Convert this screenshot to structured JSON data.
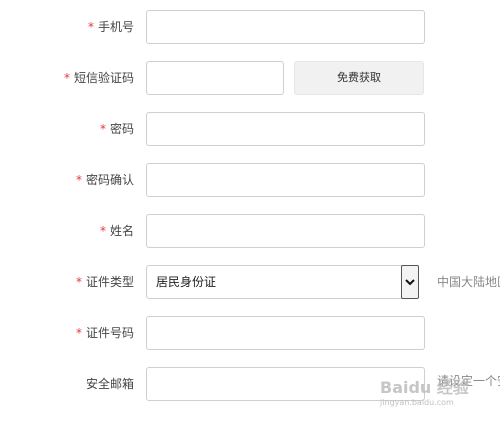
{
  "form": {
    "required_mark": "*",
    "phone": {
      "label": "手机号",
      "value": ""
    },
    "sms_code": {
      "label": "短信验证码",
      "value": "",
      "button_label": "免费获取"
    },
    "password": {
      "label": "密码",
      "value": ""
    },
    "password_confirm": {
      "label": "密码确认",
      "value": ""
    },
    "name": {
      "label": "姓名",
      "value": ""
    },
    "id_type": {
      "label": "证件类型",
      "selected": "居民身份证",
      "hint": "中国大陆地区"
    },
    "id_number": {
      "label": "证件号码",
      "value": ""
    },
    "email": {
      "label": "安全邮箱",
      "value": "",
      "hint": "请设定一个安"
    }
  },
  "watermark": {
    "text": "Baidu 经验",
    "url_text": "jingyan.baidu.com"
  }
}
